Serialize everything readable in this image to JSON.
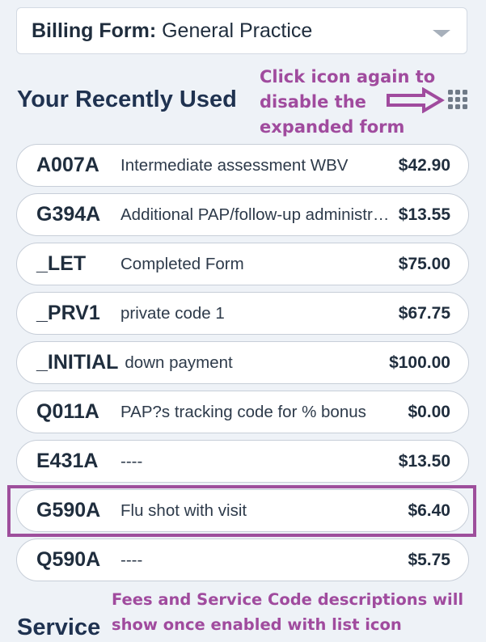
{
  "billing_form": {
    "label": "Billing Form:",
    "value": "General Practice"
  },
  "recently_used": {
    "title": "Your Recently Used",
    "items": [
      {
        "code": "A007A",
        "description": "Intermediate assessment WBV",
        "fee": "$42.90"
      },
      {
        "code": "G394A",
        "description": "Additional PAP/follow-up administration",
        "fee": "$13.55"
      },
      {
        "code": "_LET",
        "description": "Completed Form",
        "fee": "$75.00"
      },
      {
        "code": "_PRV1",
        "description": "private code 1",
        "fee": "$67.75"
      },
      {
        "code": "_INITIAL",
        "description": "down payment",
        "fee": "$100.00"
      },
      {
        "code": "Q011A",
        "description": "PAP?s tracking code for % bonus",
        "fee": "$0.00"
      },
      {
        "code": "E431A",
        "description": "----",
        "fee": "$13.50"
      },
      {
        "code": "G590A",
        "description": "Flu shot with visit",
        "fee": "$6.40"
      },
      {
        "code": "Q590A",
        "description": "----",
        "fee": "$5.75"
      }
    ]
  },
  "annotations": {
    "top": [
      "Click icon again to",
      "disable the",
      "expanded form"
    ],
    "bottom": [
      "Fees and Service Code descriptions will",
      "show once enabled with list icon"
    ]
  },
  "service_heading": "Service",
  "icons": {
    "view_toggle": "grid-icon",
    "dropdown": "chevron-down-icon",
    "annotation_arrow": "arrow-right-icon"
  },
  "colors": {
    "annotation": "#a04b9e",
    "highlight": "#9e4f9c",
    "title": "#1f3250",
    "background": "#eef2f7"
  }
}
